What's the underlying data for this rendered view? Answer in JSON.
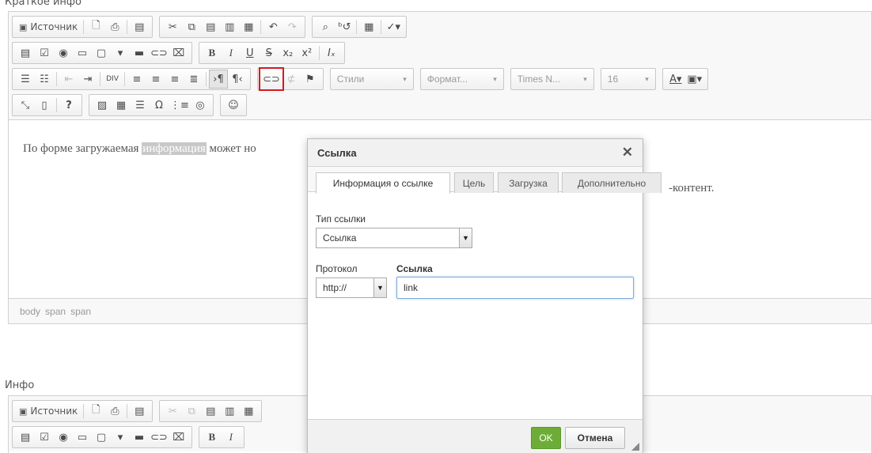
{
  "sections": {
    "top_label": "Краткое инфо",
    "bottom_label": "Инфо"
  },
  "toolbar": {
    "source_label": "Источник",
    "styles_combo": "Стили",
    "format_combo": "Формат...",
    "font_combo": "Times N...",
    "size_combo": "16"
  },
  "content": {
    "before": "По форме загружаемая ",
    "highlight": "информация",
    "after": " может но",
    "tail": "-контент."
  },
  "path_bar": [
    "body",
    "span",
    "span"
  ],
  "dialog": {
    "title": "Ссылка",
    "tabs": [
      "Информация о ссылке",
      "Цель",
      "Загрузка",
      "Дополнительно"
    ],
    "link_type_label": "Тип ссылки",
    "link_type_value": "Ссылка",
    "protocol_label": "Протокол",
    "protocol_value": "http://",
    "url_label": "Ссылка",
    "url_value": "link",
    "ok_label": "OK",
    "cancel_label": "Отмена"
  },
  "colors": {
    "ok_button": "#6dad37",
    "highlight_box": "#d7191c"
  }
}
